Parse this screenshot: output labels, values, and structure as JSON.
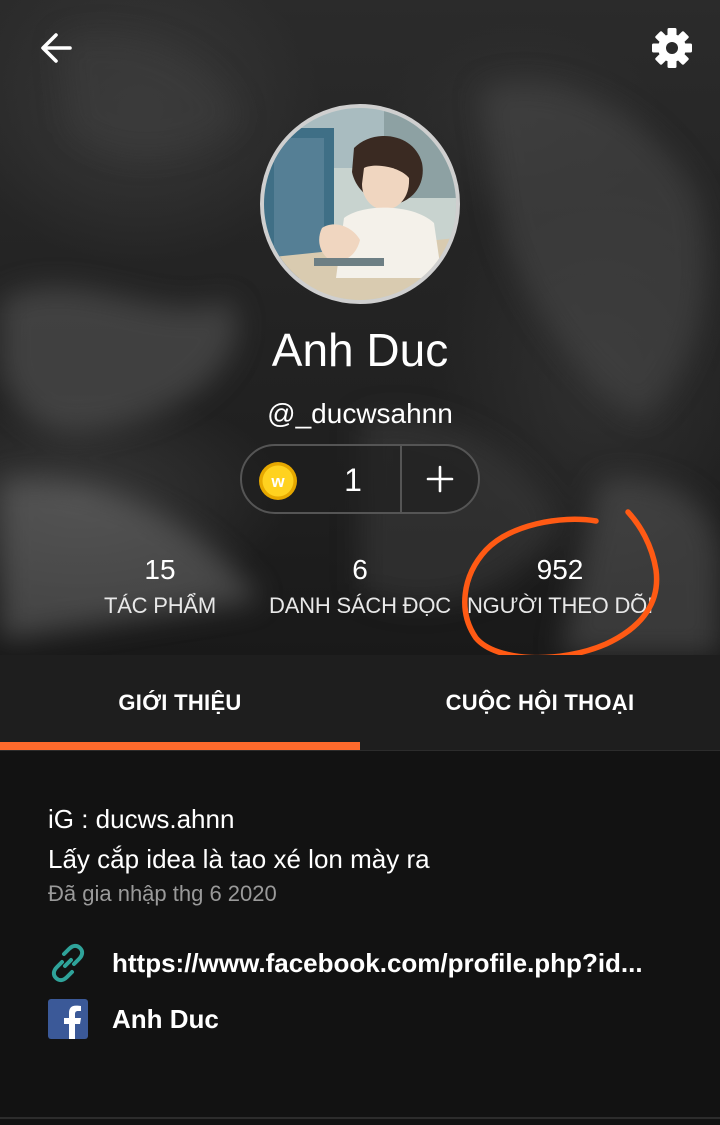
{
  "header": {
    "back_icon": "arrow-left-icon",
    "settings_icon": "gear-icon"
  },
  "profile": {
    "display_name": "Anh Duc",
    "username": "@_ducwsahnn",
    "avatar_alt": "Anh Duc"
  },
  "coins": {
    "icon": "wattpad-coin-icon",
    "coin_letter": "w",
    "count": "1",
    "add_icon": "plus-icon"
  },
  "stats": [
    {
      "value": "15",
      "label": "TÁC PHẨM"
    },
    {
      "value": "6",
      "label": "DANH SÁCH ĐỌC"
    },
    {
      "value": "952",
      "label": "NGƯỜI THEO DÕI"
    }
  ],
  "tabs": [
    {
      "label": "GIỚI THIỆU",
      "active": true
    },
    {
      "label": "CUỘC HỘI THOẠI",
      "active": false
    }
  ],
  "about": {
    "bio_lines": [
      "iG : ducws.ahnn",
      "Lấy cắp idea là tao xé lon mày ra"
    ],
    "joined": "Đã gia nhập thg 6 2020",
    "links": [
      {
        "icon": "link-icon",
        "text": "https://www.facebook.com/profile.php?id..."
      },
      {
        "icon": "facebook-icon",
        "text": "Anh Duc"
      }
    ]
  },
  "colors": {
    "accent": "#ff6a2c",
    "annotation": "#ff5a14",
    "link_icon": "#2fa39a",
    "facebook": "#3b5998",
    "coin": "#f2b705"
  }
}
